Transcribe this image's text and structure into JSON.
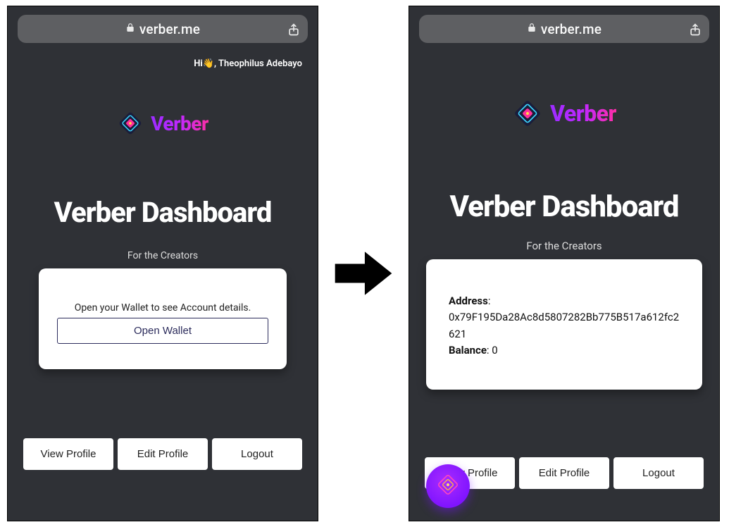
{
  "browser": {
    "url": "verber.me"
  },
  "brand": "Verber",
  "greeting": {
    "prefix": "Hi",
    "wave": "👋",
    "sep": ",",
    "name": "Theophilus Adebayo"
  },
  "dashboard": {
    "title": "Verber Dashboard",
    "subtitle": "For the Creators"
  },
  "wallet_closed": {
    "prompt": "Open your Wallet to see Account details.",
    "open_label": "Open Wallet"
  },
  "wallet_open": {
    "address_label": "Address",
    "address_value": "0x79F195Da28Ac8d5807282Bb775B517a612fc2621",
    "balance_label": "Balance",
    "balance_value": "0"
  },
  "actions": {
    "view_profile": "View Profile",
    "edit_profile": "Edit Profile",
    "logout": "Logout"
  },
  "colors": {
    "bg": "#2f3136",
    "accent_start": "#9b2cff",
    "accent_end": "#ff2ea6"
  }
}
